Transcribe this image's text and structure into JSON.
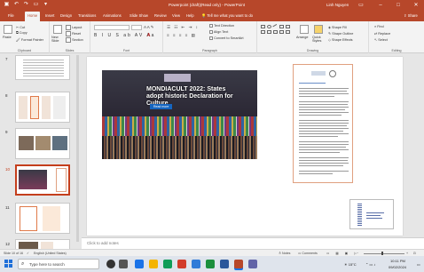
{
  "app": {
    "title": "Powerpoint (draft)(Read only) - PowerPoint",
    "user": "Linh Nguyen",
    "accent": "#b7472a"
  },
  "tabs": [
    "File",
    "Home",
    "Insert",
    "Design",
    "Transitions",
    "Animations",
    "Slide Show",
    "Review",
    "View",
    "Help",
    "Tell me what you want to do"
  ],
  "share_label": "Share",
  "ribbon": {
    "clipboard": {
      "paste": "Paste",
      "cut": "Cut",
      "copy": "Copy",
      "format_painter": "Format Painter",
      "label": "Clipboard"
    },
    "slides": {
      "new_slide": "New Slide",
      "layout": "Layout",
      "reset": "Reset",
      "section": "Section",
      "label": "Slides"
    },
    "font": {
      "label": "Font"
    },
    "paragraph": {
      "text_direction": "Text Direction",
      "align_text": "Align Text",
      "smartart": "Convert to SmartArt",
      "label": "Paragraph"
    },
    "drawing": {
      "arrange": "Arrange",
      "quick_styles": "Quick Styles",
      "shape_fill": "Shape Fill",
      "shape_outline": "Shape Outline",
      "shape_effects": "Shape Effects",
      "label": "Drawing"
    },
    "editing": {
      "find": "Find",
      "replace": "Replace",
      "select": "Select",
      "label": "Editing"
    }
  },
  "slide_numbers": [
    "7",
    "8",
    "9",
    "10",
    "11",
    "12"
  ],
  "slide": {
    "headline": "MONDIACULT 2022: States adopt historic Declaration for Culture",
    "more_button": "Read more"
  },
  "notes_placeholder": "Click to add notes",
  "status": {
    "slide_info": "Slide 10 of 16",
    "language": "English (United States)",
    "notes": "Notes",
    "comments": "Comments"
  },
  "taskbar": {
    "search_placeholder": "Type here to search",
    "weather": "15°C",
    "time": "10:11 PM",
    "date": "09/02/2024"
  }
}
